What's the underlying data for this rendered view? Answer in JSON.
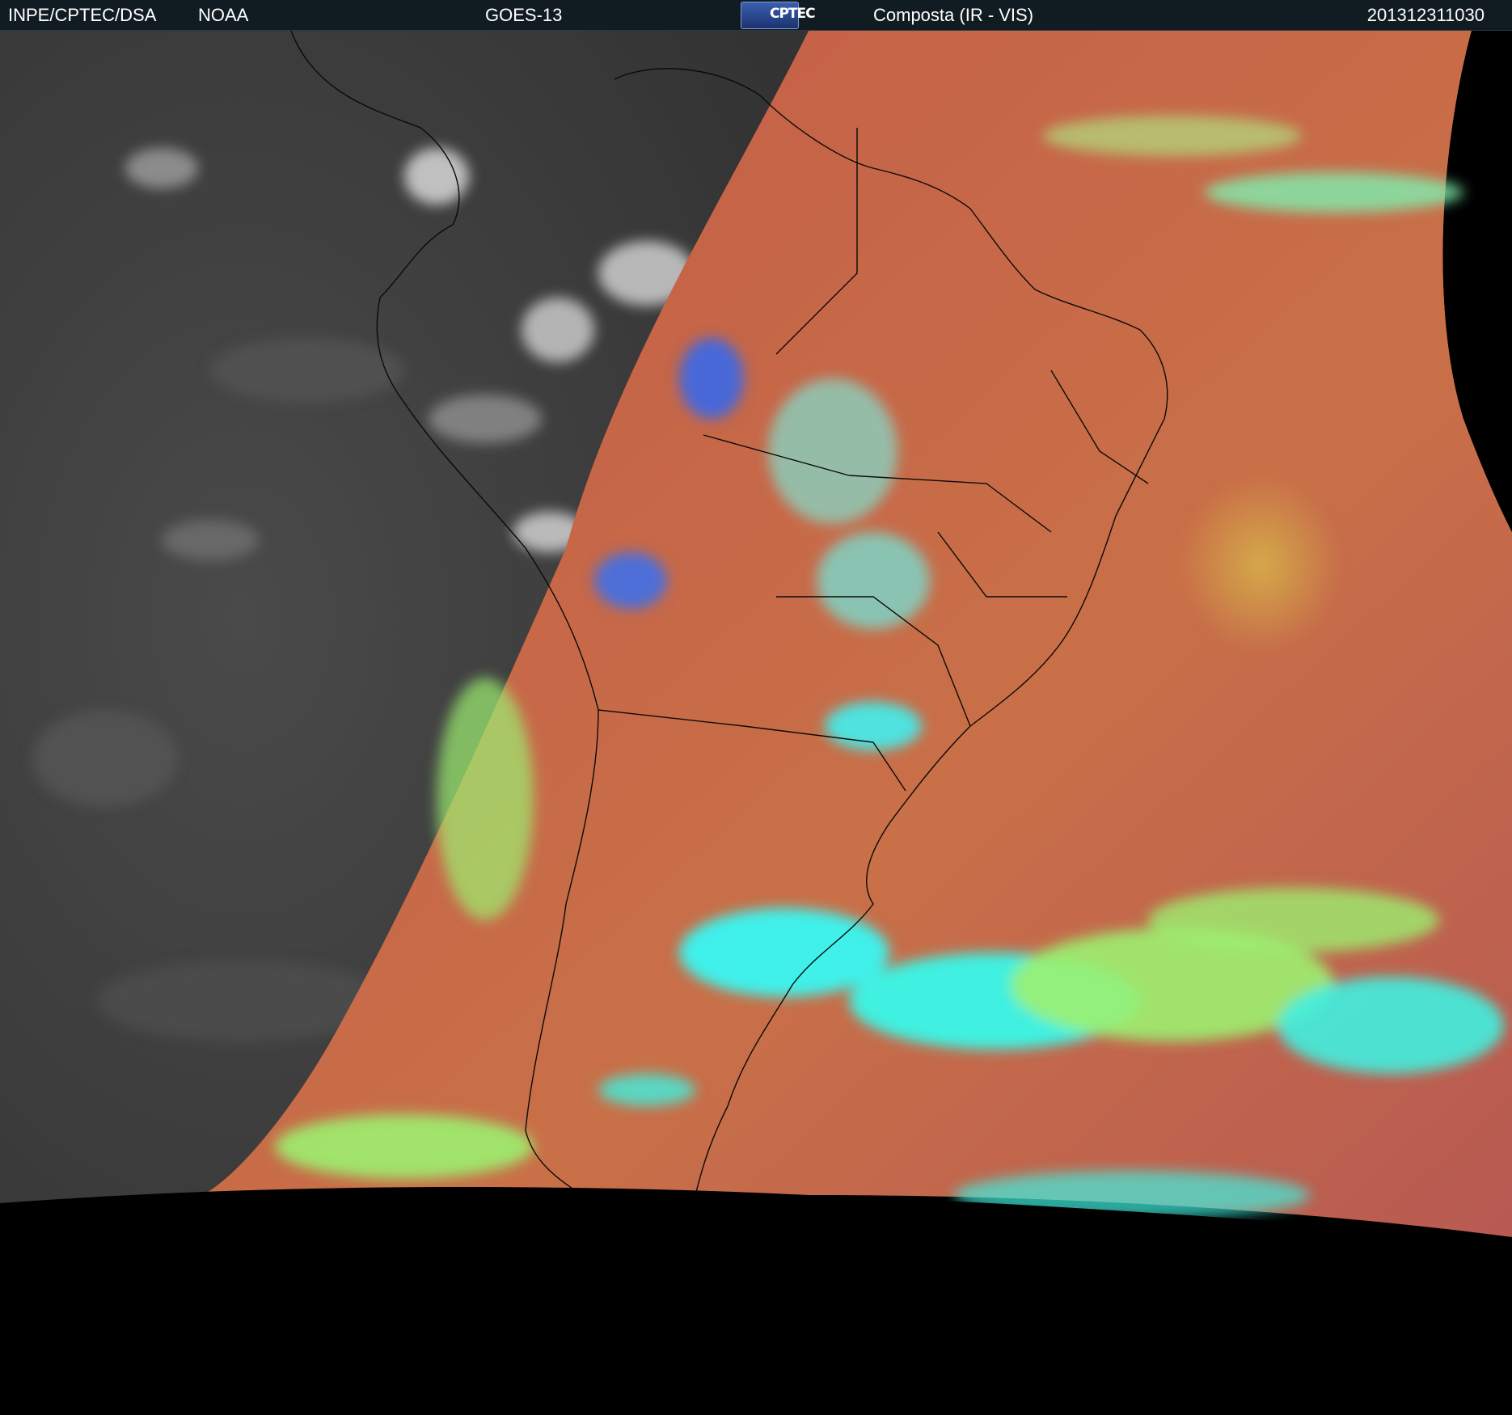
{
  "header": {
    "org": "INPE/CPTEC/DSA",
    "agency": "NOAA",
    "satellite": "GOES-13",
    "logo_text": "CPTEC",
    "product": "Composta (IR - VIS)",
    "timestamp": "201312311030"
  },
  "scene": {
    "colors": {
      "header_bg": "#111c22",
      "night_side": "#3a3a3a",
      "day_land": "#b3564a",
      "day_ocean_warm": "#c9704a",
      "high_cloud": "#3ff0e0",
      "mid_cloud": "#9cf070",
      "convective": "#3a6fe6",
      "space": "#000000"
    }
  }
}
